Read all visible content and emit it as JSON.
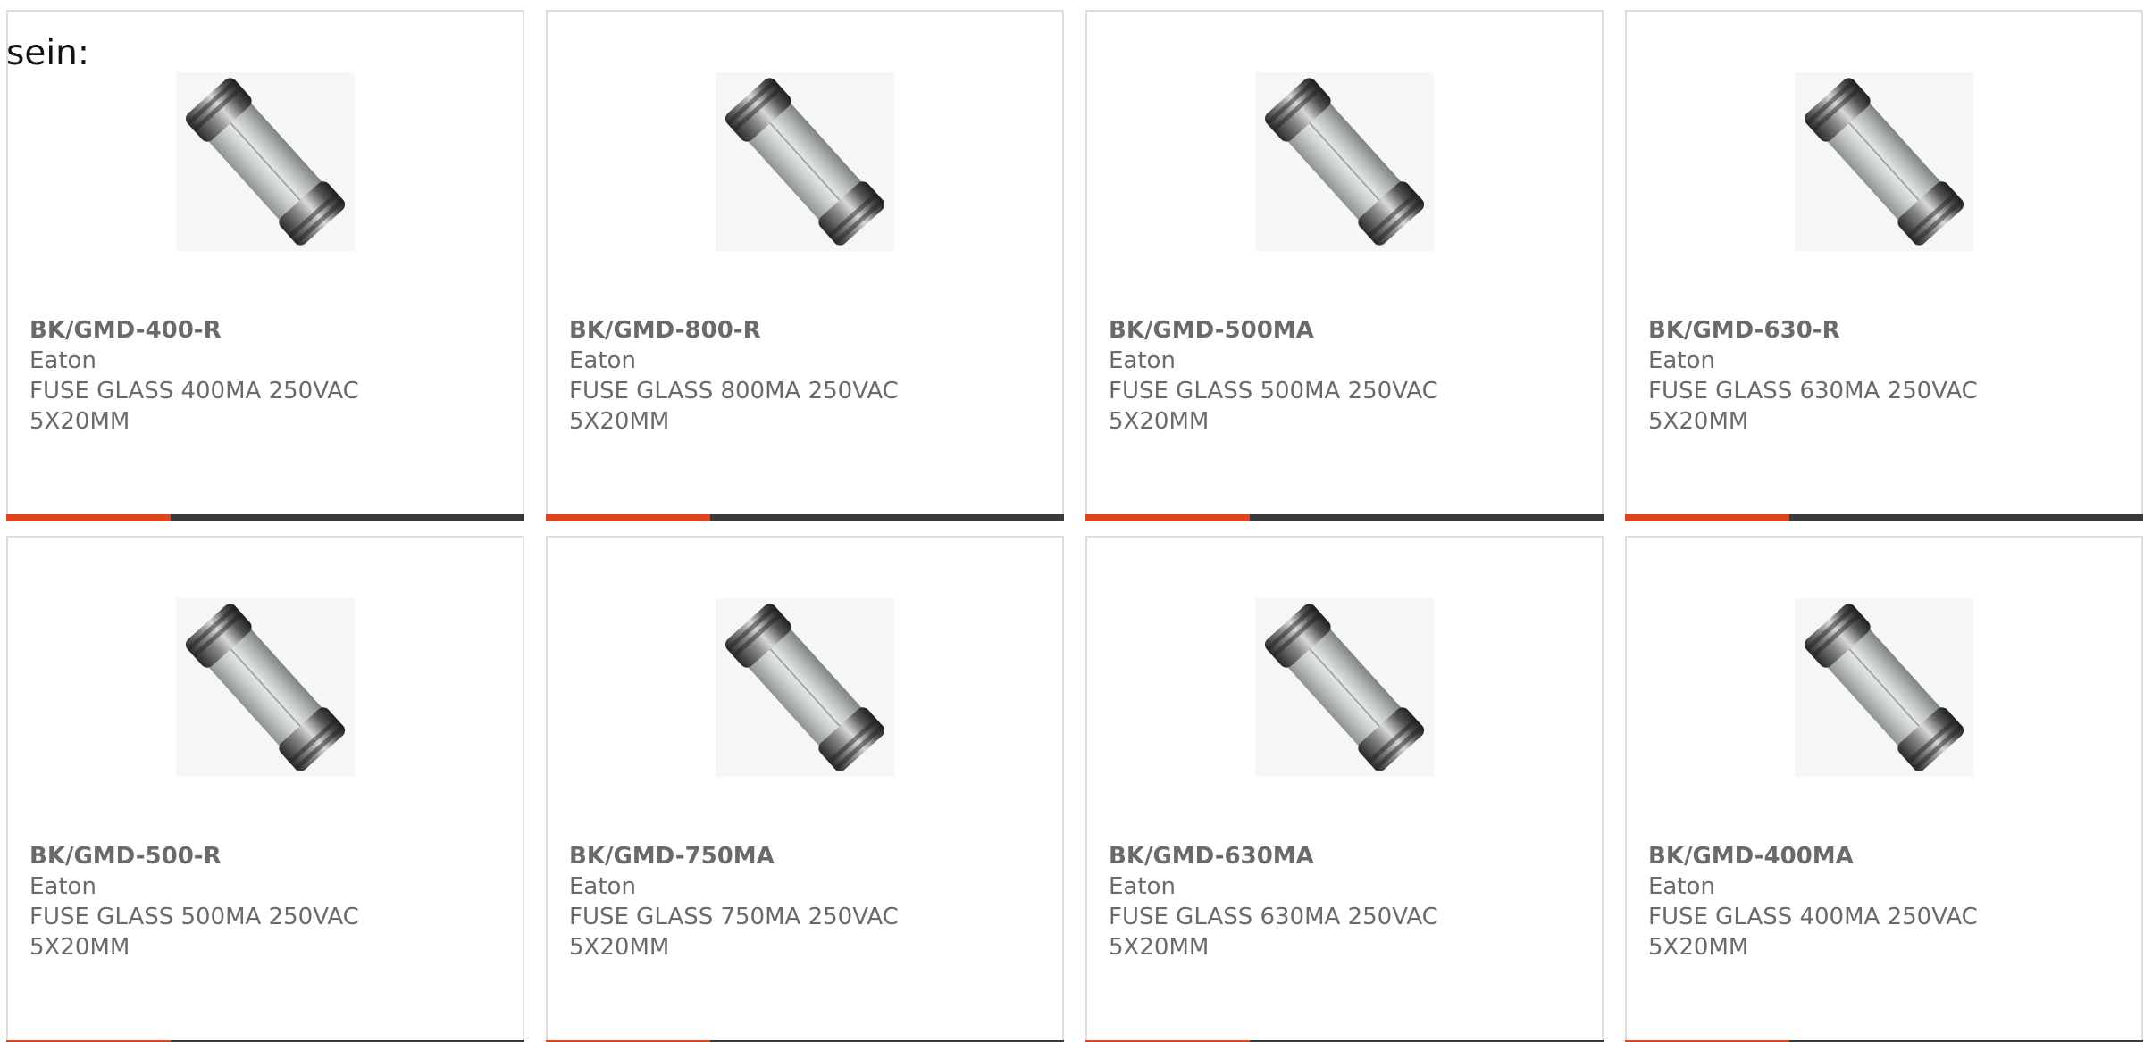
{
  "intro_text": "sein:",
  "colors": {
    "accent": "#e0441c",
    "bar_dark": "#3a3a3a",
    "border": "#dddddd",
    "text": "#6a6a6a"
  },
  "products": [
    {
      "part": "BK/GMD-400-R",
      "brand": "Eaton",
      "description": "FUSE GLASS 400MA 250VAC 5X20MM",
      "image_icon": "glass-fuse-image"
    },
    {
      "part": "BK/GMD-800-R",
      "brand": "Eaton",
      "description": "FUSE GLASS 800MA 250VAC 5X20MM",
      "image_icon": "glass-fuse-image"
    },
    {
      "part": "BK/GMD-500MA",
      "brand": "Eaton",
      "description": "FUSE GLASS 500MA 250VAC 5X20MM",
      "image_icon": "glass-fuse-image"
    },
    {
      "part": "BK/GMD-630-R",
      "brand": "Eaton",
      "description": "FUSE GLASS 630MA 250VAC 5X20MM",
      "image_icon": "glass-fuse-image"
    },
    {
      "part": "BK/GMD-500-R",
      "brand": "Eaton",
      "description": "FUSE GLASS 500MA 250VAC 5X20MM",
      "image_icon": "glass-fuse-image"
    },
    {
      "part": "BK/GMD-750MA",
      "brand": "Eaton",
      "description": "FUSE GLASS 750MA 250VAC 5X20MM",
      "image_icon": "glass-fuse-image"
    },
    {
      "part": "BK/GMD-630MA",
      "brand": "Eaton",
      "description": "FUSE GLASS 630MA 250VAC 5X20MM",
      "image_icon": "glass-fuse-image"
    },
    {
      "part": "BK/GMD-400MA",
      "brand": "Eaton",
      "description": "FUSE GLASS 400MA 250VAC 5X20MM",
      "image_icon": "glass-fuse-image"
    }
  ]
}
